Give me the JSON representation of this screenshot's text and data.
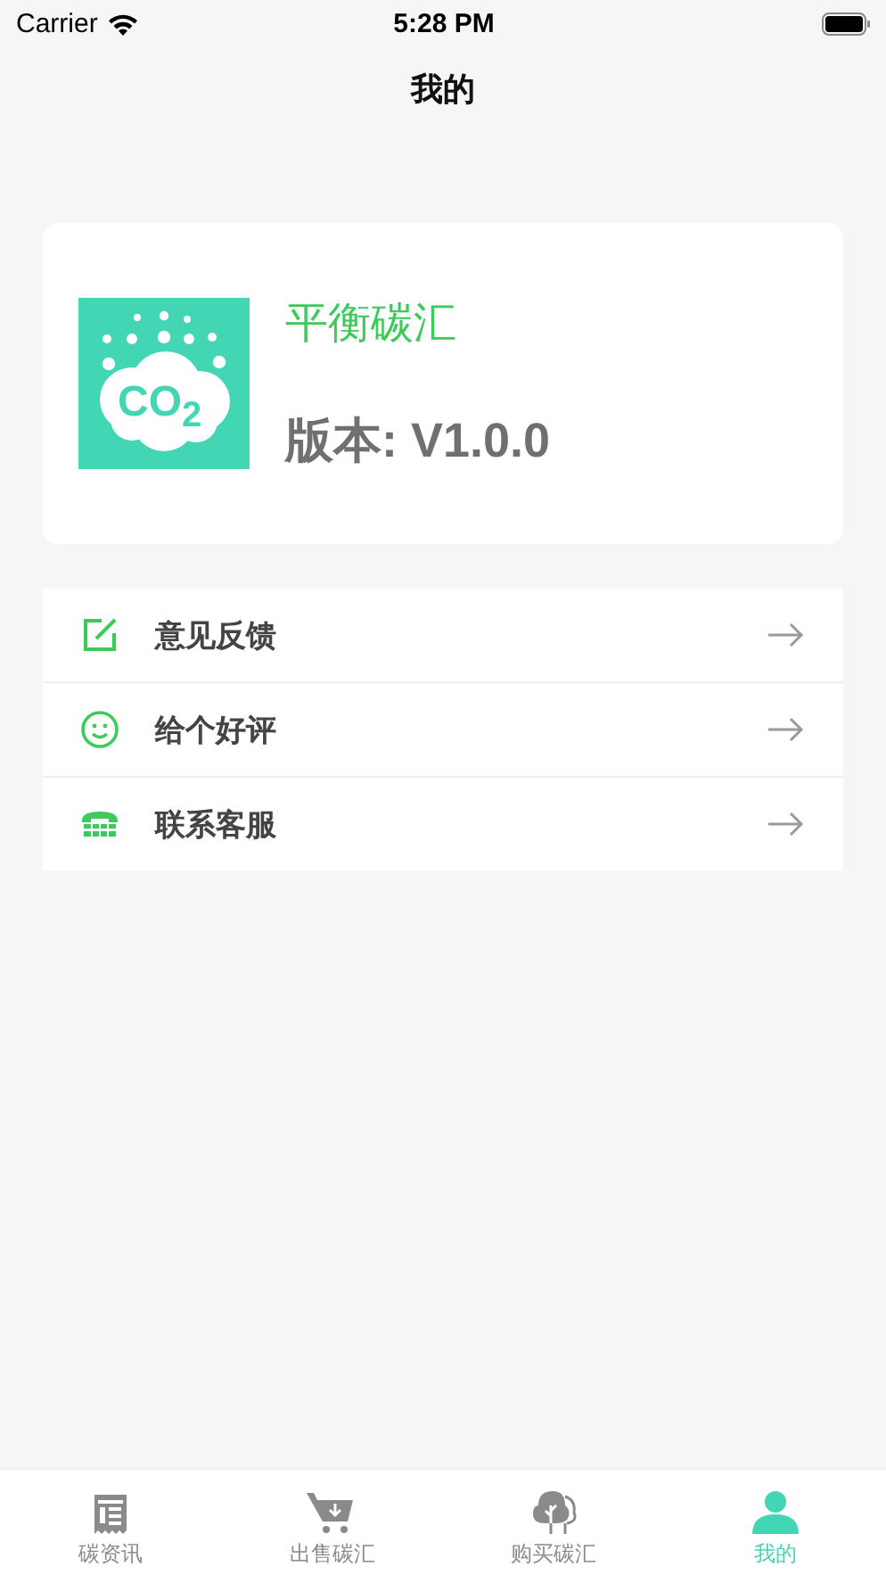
{
  "status_bar": {
    "carrier": "Carrier",
    "time": "5:28 PM"
  },
  "nav": {
    "title": "我的"
  },
  "app_card": {
    "logo_text": "CO$_{2}$",
    "name": "平衡碳汇",
    "version": "版本: V1.0.0"
  },
  "menu": [
    {
      "kind": "feedback",
      "label": "意见反馈"
    },
    {
      "kind": "rate",
      "label": "给个好评"
    },
    {
      "kind": "contact",
      "label": "联系客服"
    }
  ],
  "tab_bar": [
    {
      "kind": "news",
      "label": "碳资讯",
      "selected": false
    },
    {
      "kind": "sell",
      "label": "出售碳汇",
      "selected": false
    },
    {
      "kind": "buy",
      "label": "购买碳汇",
      "selected": false
    },
    {
      "kind": "me",
      "label": "我的",
      "selected": true
    }
  ]
}
